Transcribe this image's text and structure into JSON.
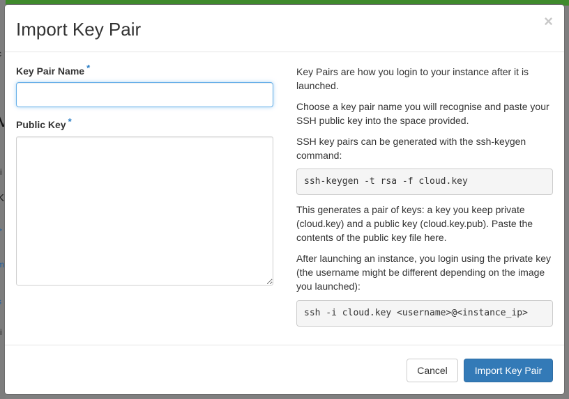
{
  "modal": {
    "title": "Import Key Pair",
    "close_glyph": "×"
  },
  "form": {
    "key_pair_name": {
      "label": "Key Pair Name",
      "required_mark": "*",
      "value": "",
      "placeholder": ""
    },
    "public_key": {
      "label": "Public Key",
      "required_mark": "*",
      "value": ""
    }
  },
  "help": {
    "p1": "Key Pairs are how you login to your instance after it is launched.",
    "p2": "Choose a key pair name you will recognise and paste your SSH public key into the space provided.",
    "p3": "SSH key pairs can be generated with the ssh-keygen command:",
    "code1": "ssh-keygen -t rsa -f cloud.key",
    "p4": "This generates a pair of keys: a key you keep private (cloud.key) and a public key (cloud.key.pub). Paste the contents of the public key file here.",
    "p5": "After launching an instance, you login using the private key (the username might be different depending on the image you launched):",
    "code2": "ssh -i cloud.key <username>@<instance_ip>"
  },
  "footer": {
    "cancel_label": "Cancel",
    "submit_label": "Import Key Pair"
  },
  "colors": {
    "primary": "#337ab7",
    "required": "#2a7dc4",
    "focus_border": "#66afe9",
    "backdrop": "#7f7f7f"
  }
}
